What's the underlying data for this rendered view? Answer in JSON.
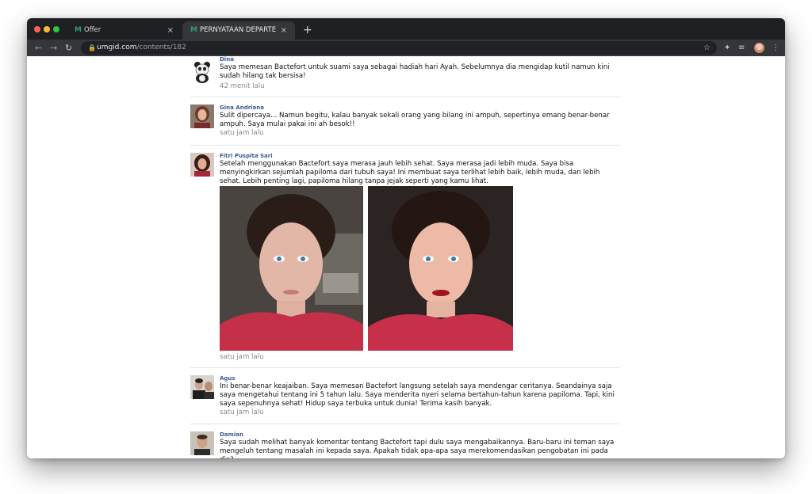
{
  "browser": {
    "tabs": [
      {
        "favicon": "M",
        "label": "Offer",
        "close": "×"
      },
      {
        "favicon": "M",
        "label": "PERNYATAAN DEPARTEMEN K",
        "close": "×"
      }
    ],
    "new_tab": "+",
    "nav": {
      "back": "←",
      "forward": "→",
      "reload": "↻"
    },
    "url_domain": "umgid.com",
    "url_path": "/contents/182",
    "star": "☆",
    "toolbar_icons": {
      "extensions": "✦",
      "media": "≡",
      "menu": "⋮"
    },
    "traffic_colors": [
      "#ff5f57",
      "#febc2e",
      "#28c840"
    ]
  },
  "comments": [
    {
      "name": "Dina",
      "text": "Saya memesan Bactefort untuk suami saya sebagai hadiah hari Ayah. Sebelumnya dia mengidap kutil namun kini sudah hilang tak bersisa!",
      "time": "42 menit lalu"
    },
    {
      "name": "Gina Andriana",
      "text": "Sulit dipercaya... Namun begitu, kalau banyak sekali orang yang bilang ini ampuh, sepertinya emang benar-benar ampuh. Saya mulai pakai ini ah besok!!",
      "time": "satu jam lalu"
    },
    {
      "name": "Fitri Puspita Sari",
      "text": "Setelah menggunakan Bactefort saya merasa jauh lebih sehat. Saya merasa jadi lebih muda. Saya bisa menyingkirkan sejumlah papiloma dari tubuh saya! Ini membuat saya terlihat lebih baik, lebih muda, dan lebih sehat. Lebih penting lagi, papiloma hilang tanpa jejak seperti yang kamu lihat.",
      "time": "satu jam lalu"
    },
    {
      "name": "Agus",
      "text": "Ini benar-benar keajaiban. Saya memesan Bactefort langsung setelah saya mendengar ceritanya. Seandainya saja saya mengetahui tentang ini 5 tahun lalu. Saya menderita nyeri selama bertahun-tahun karena papiloma. Tapi, kini saya sepenuhnya sehat! Hidup saya terbuka untuk dunia! Terima kasih banyak.",
      "time": "satu jam lalu"
    },
    {
      "name": "Damian",
      "text": "Saya sudah melihat banyak komentar tentang Bactefort tapi dulu saya mengabaikannya. Baru-baru ini teman saya mengeluh tentang masalah ini kepada saya. Apakah tidak apa-apa saya merekomendasikan pengobatan ini pada dia?",
      "time": ""
    }
  ]
}
